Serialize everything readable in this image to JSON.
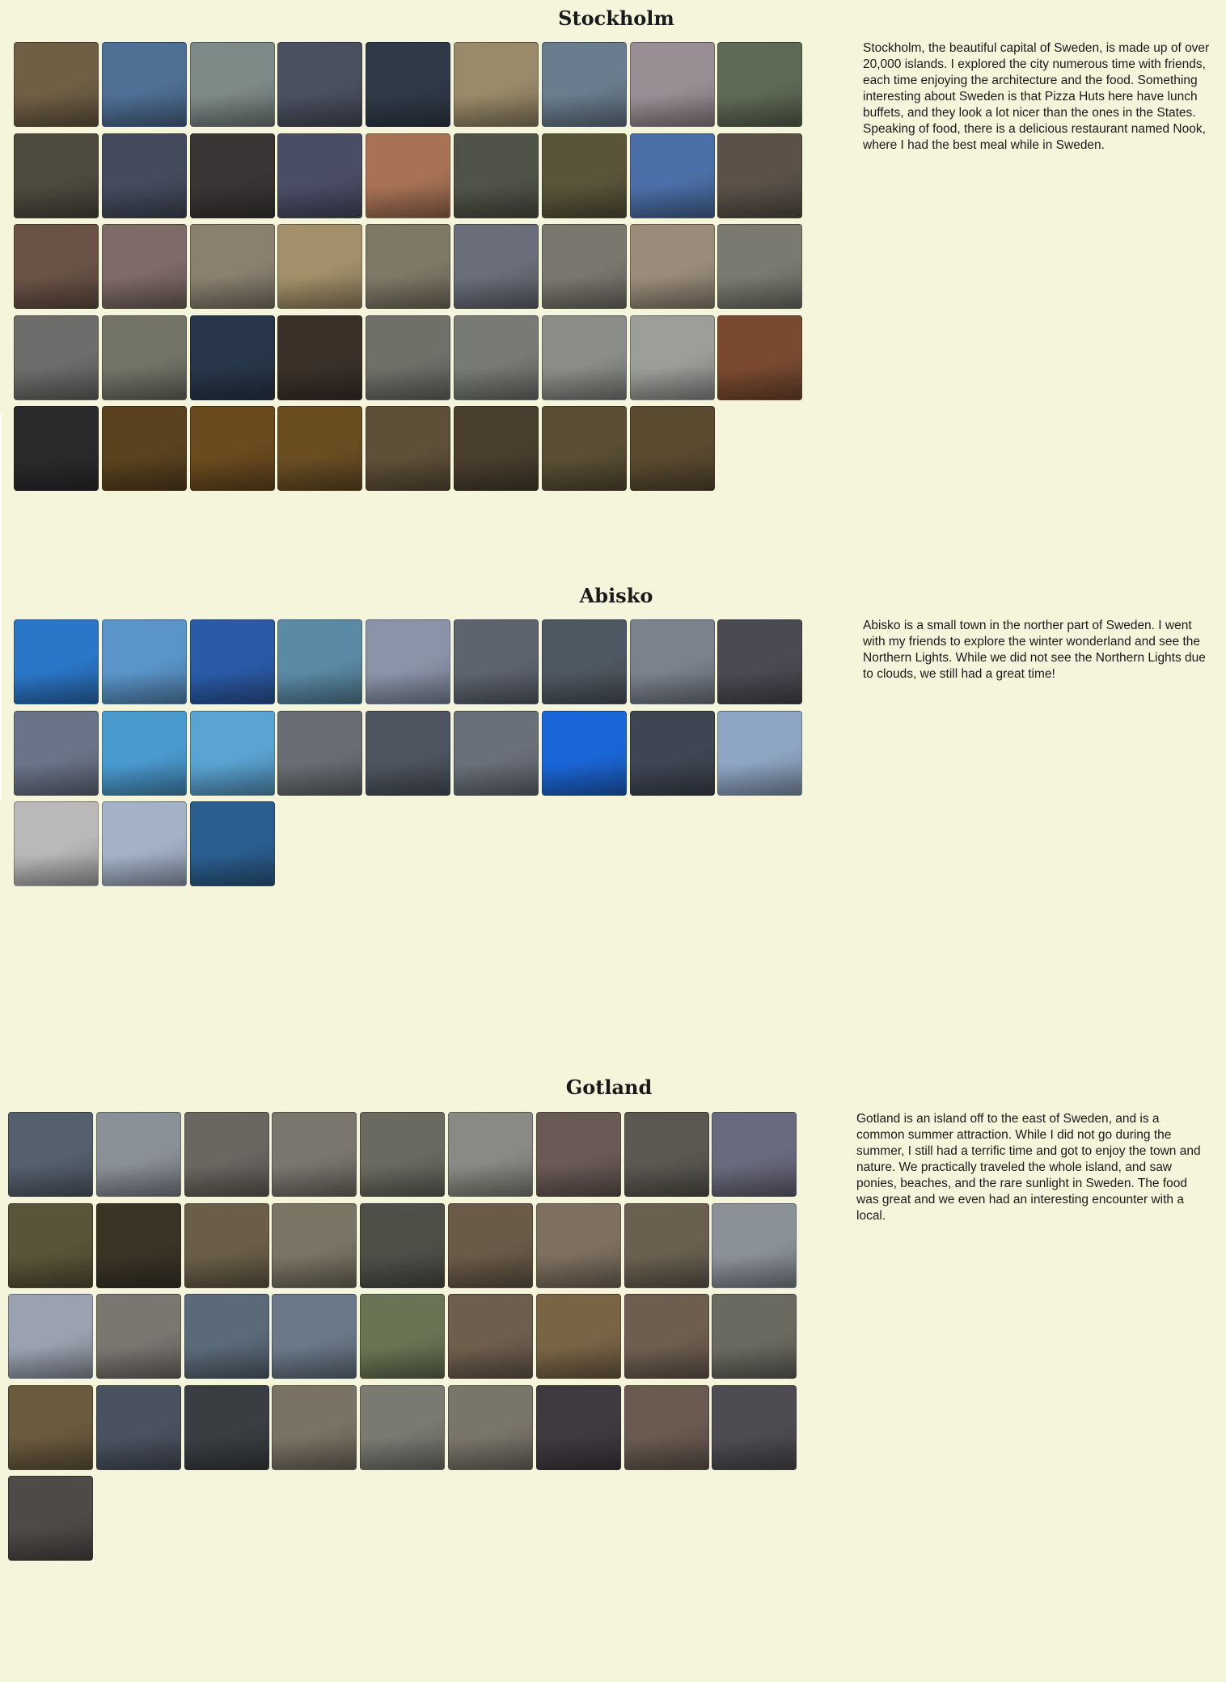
{
  "sections": [
    {
      "id": "stockholm",
      "title": "Stockholm",
      "description": "Stockholm, the beautiful capital of Sweden, is made up of over 20,000 islands. I explored the city numerous time with friends, each time enjoying the architecture and the food. Something interesting about Sweden is that Pizza Huts here have lunch buffets, and they look a lot nicer than the ones in the States. Speaking of food, there is a delicious restaurant named Nook, where I had the best meal while in Sweden.",
      "photo_colors": [
        "#6f5f45",
        "#4f6f95",
        "#7e8a88",
        "#4a5060",
        "#2f3a48",
        "#9a8a6a",
        "#6a7d8e",
        "#9a8e95",
        "#5e6a55",
        "#4e4a3e",
        "#444b5d",
        "#3a3535",
        "#4a4d66",
        "#a87255",
        "#505448",
        "#5a553a",
        "#4b6fa8",
        "#5b5148",
        "#6a5246",
        "#7e6a66",
        "#8a8070",
        "#a3906a",
        "#7e7866",
        "#6a6e7a",
        "#7a786e",
        "#9a8c7a",
        "#7a7a70",
        "#6d6e6c",
        "#737467",
        "#27364a",
        "#3a3028",
        "#6f7068",
        "#777a75",
        "#8a8d88",
        "#9c9e9a",
        "#7a4a30",
        "#2a2a2c",
        "#5a421e",
        "#6a4a1e",
        "#6a4e22",
        "#5e5038",
        "#4a3e2e",
        "#5a4e34",
        "#5a4a30"
      ]
    },
    {
      "id": "abisko",
      "title": "Abisko",
      "description": "Abisko is a small town in the norther part of Sweden. I went with my friends to explore the winter wonderland and see the Northern Lights. While we did not see the Northern Lights due to clouds, we still had a great time!",
      "photo_colors": [
        "#2a76c8",
        "#5a94c8",
        "#2a5aa8",
        "#5a8aa6",
        "#8a94a8",
        "#5d6470",
        "#4e5862",
        "#7a828e",
        "#4a4a52",
        "#6a7488",
        "#4a9ad0",
        "#5aa4d4",
        "#6a6e74",
        "#4e5560",
        "#6a707a",
        "#1a66d8",
        "#3e4654",
        "#8ea6c4",
        "#bab8b8",
        "#a4b2c8",
        "#2a5e90"
      ]
    },
    {
      "id": "gotland",
      "title": "Gotland",
      "description": "Gotland is an island off to the east of Sweden, and is a common summer attraction. While I did not go during the summer, I still had a terrific time and got to enjoy the town and nature. We practically traveled the whole island, and saw ponies, beaches, and the rare sunlight in Sweden. The food was great and we even had an interesting encounter with a local.",
      "photo_colors": [
        "#55606e",
        "#8a9098",
        "#6a6660",
        "#7a766e",
        "#6a6a60",
        "#8a8a84",
        "#6a5a55",
        "#5a5850",
        "#6a6a7e",
        "#5a5438",
        "#3a3426",
        "#6a5e48",
        "#7a7464",
        "#4e5048",
        "#6a5a48",
        "#7e7060",
        "#6a6050",
        "#8a9298",
        "#9aa2b0",
        "#7a7670",
        "#5a6a78",
        "#6a7888",
        "#6a7454",
        "#6e5e4e",
        "#7a6446",
        "#6e5e50",
        "#6a6a60",
        "#6a5a3e",
        "#4a5260",
        "#3a3e42",
        "#7a7264",
        "#7a7a72",
        "#7a756a",
        "#3e3a40",
        "#6a5a50",
        "#4e4c52",
        "#4e4a48"
      ]
    }
  ]
}
